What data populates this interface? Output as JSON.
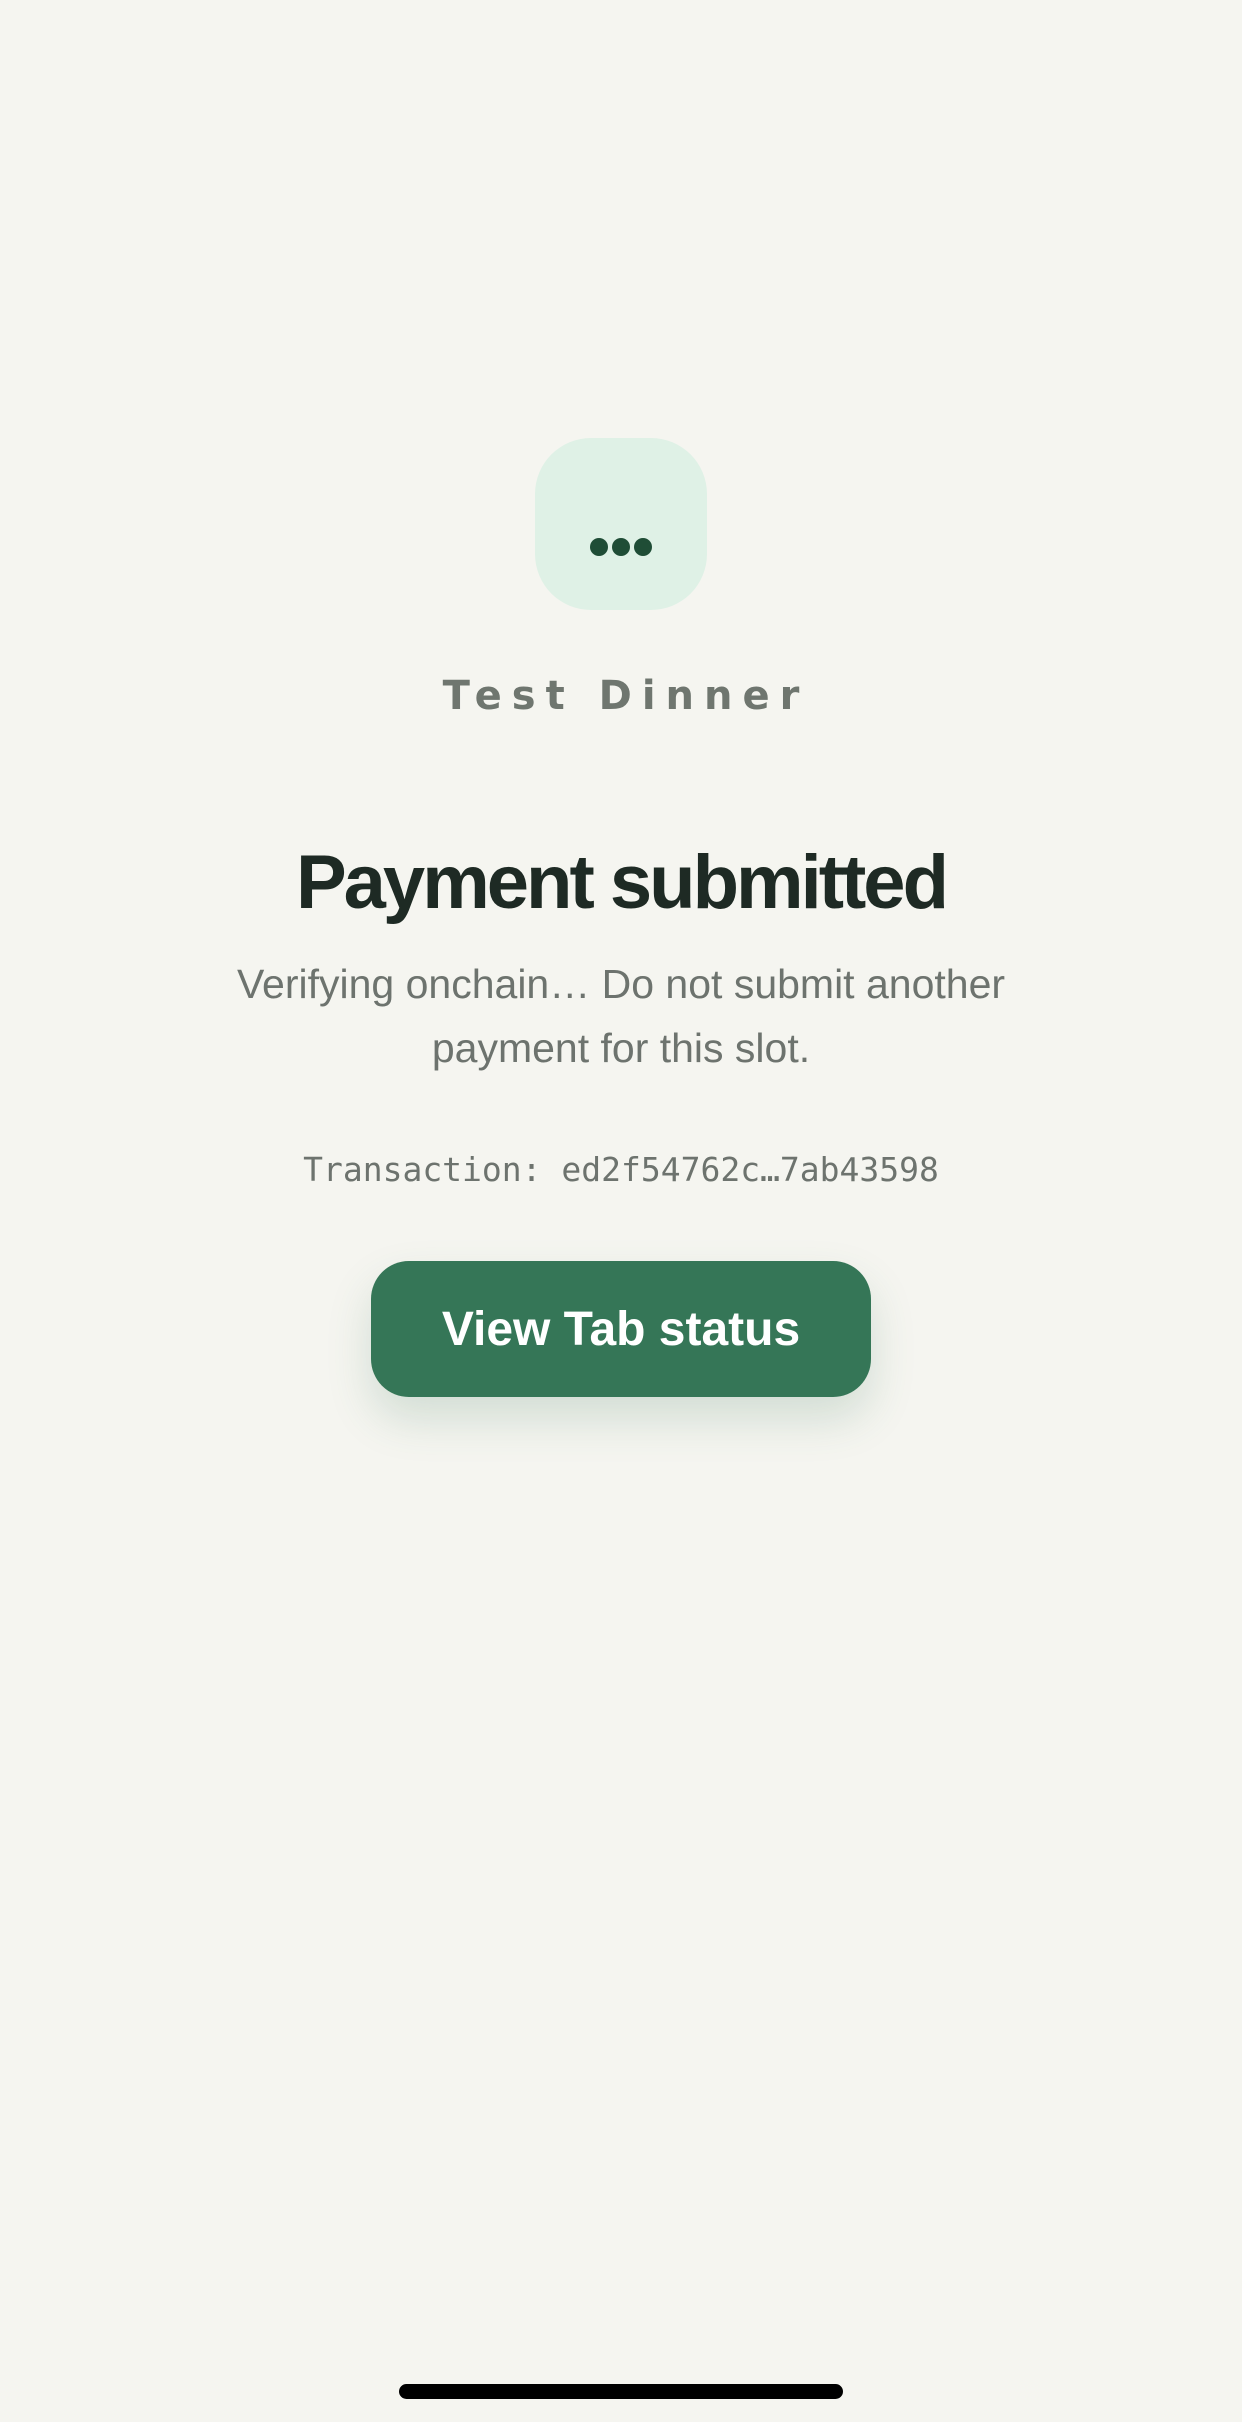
{
  "header": {
    "status_icon": "ellipsis-icon",
    "merchant_name": "Test Dinner"
  },
  "main": {
    "title": "Payment submitted",
    "message": "Verifying onchain… Do not submit another payment for this slot.",
    "transaction": "Transaction: ed2f54762c…7ab43598",
    "button_label": "View Tab status"
  },
  "colors": {
    "background": "#f5f5f0",
    "accent": "#357657",
    "icon_tile": "#dff1e6",
    "icon_dots": "#1f4d36",
    "title": "#1e2a24",
    "muted_text": "#6d736e"
  }
}
